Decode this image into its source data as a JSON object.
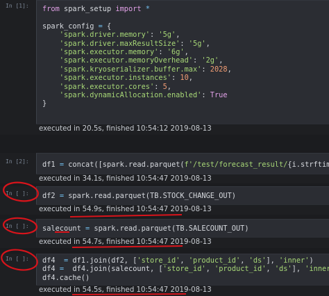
{
  "cells": [
    {
      "prompt": "In [1]:",
      "lines": [
        [
          {
            "t": "from ",
            "c": "kw"
          },
          {
            "t": "spark_setup ",
            "c": "fn"
          },
          {
            "t": "import",
            "c": "kw"
          },
          {
            "t": " *",
            "c": "op"
          }
        ],
        [],
        [
          {
            "t": "spark_config ",
            "c": "fn"
          },
          {
            "t": "=",
            "c": "op"
          },
          {
            "t": " {",
            "c": "fn"
          }
        ],
        [
          {
            "t": "    'spark.driver.memory'",
            "c": "str"
          },
          {
            "t": ": ",
            "c": "fn"
          },
          {
            "t": "'5g'",
            "c": "str"
          },
          {
            "t": ",",
            "c": "fn"
          }
        ],
        [
          {
            "t": "    'spark.driver.maxResultSize'",
            "c": "str"
          },
          {
            "t": ": ",
            "c": "fn"
          },
          {
            "t": "'5g'",
            "c": "str"
          },
          {
            "t": ",",
            "c": "fn"
          }
        ],
        [
          {
            "t": "    'spark.executor.memory'",
            "c": "str"
          },
          {
            "t": ": ",
            "c": "fn"
          },
          {
            "t": "'6g'",
            "c": "str"
          },
          {
            "t": ",",
            "c": "fn"
          }
        ],
        [
          {
            "t": "    'spark.executor.memoryOverhead'",
            "c": "str"
          },
          {
            "t": ": ",
            "c": "fn"
          },
          {
            "t": "'2g'",
            "c": "str"
          },
          {
            "t": ",",
            "c": "fn"
          }
        ],
        [
          {
            "t": "    'spark.kryoserializer.buffer.max'",
            "c": "str"
          },
          {
            "t": ": ",
            "c": "fn"
          },
          {
            "t": "2028",
            "c": "num"
          },
          {
            "t": ",",
            "c": "fn"
          }
        ],
        [
          {
            "t": "    'spark.executor.instances'",
            "c": "str"
          },
          {
            "t": ": ",
            "c": "fn"
          },
          {
            "t": "10",
            "c": "num"
          },
          {
            "t": ",",
            "c": "fn"
          }
        ],
        [
          {
            "t": "    'spark.executor.cores'",
            "c": "str"
          },
          {
            "t": ": ",
            "c": "fn"
          },
          {
            "t": "5",
            "c": "num"
          },
          {
            "t": ",",
            "c": "fn"
          }
        ],
        [
          {
            "t": "    'spark.dynamicAllocation.enabled'",
            "c": "str"
          },
          {
            "t": ": ",
            "c": "fn"
          },
          {
            "t": "True",
            "c": "tr"
          }
        ],
        [
          {
            "t": "}",
            "c": "fn"
          }
        ],
        [],
        [],
        [
          {
            "t": "spark ",
            "c": "fn"
          },
          {
            "t": "=",
            "c": "op"
          },
          {
            "t": " start_spark_session(",
            "c": "fn"
          },
          {
            "t": "'demand'",
            "c": "str"
          },
          {
            "t": ", master",
            "c": "fn"
          },
          {
            "t": "=",
            "c": "op"
          },
          {
            "t": "'yarn'",
            "c": "str"
          },
          {
            "t": ", spark_config",
            "c": "fn"
          },
          {
            "t": "=",
            "c": "op"
          },
          {
            "t": "spar",
            "c": "fn"
          }
        ]
      ],
      "exec": "executed in 20.5s, finished 10:54:12 2019-08-13"
    },
    {
      "prompt": "In [2]:",
      "lines": [
        [
          {
            "t": "df1 ",
            "c": "fn"
          },
          {
            "t": "=",
            "c": "op"
          },
          {
            "t": " concat([spark.read.parquet(",
            "c": "fn"
          },
          {
            "t": "f'/test/forecast_result/",
            "c": "str"
          },
          {
            "t": "{i.strftime(",
            "c": "fn"
          },
          {
            "t": "\"%",
            "c": "str"
          }
        ]
      ],
      "exec": "executed in 34.1s, finished 10:54:47 2019-08-13"
    },
    {
      "prompt": "In [ ]:",
      "lines": [
        [
          {
            "t": "df2 ",
            "c": "fn"
          },
          {
            "t": "=",
            "c": "op"
          },
          {
            "t": " spark.read.parquet(TB.STOCK_CHANGE_OUT)",
            "c": "fn"
          }
        ]
      ],
      "exec": "executed in 54.9s, finished 10:54:47 2019-08-13"
    },
    {
      "prompt": "In [ ]:",
      "lines": [
        [
          {
            "t": "salecount ",
            "c": "fn"
          },
          {
            "t": "=",
            "c": "op"
          },
          {
            "t": " spark.read.parquet(TB.SALECOUNT_OUT)",
            "c": "fn"
          }
        ]
      ],
      "exec": "executed in 54.7s, finished 10:54:47 2019-08-13"
    },
    {
      "prompt": "In [ ]:",
      "lines": [
        [
          {
            "t": "df4  ",
            "c": "fn"
          },
          {
            "t": "=",
            "c": "op"
          },
          {
            "t": " df1.join(df2, [",
            "c": "fn"
          },
          {
            "t": "'store_id'",
            "c": "str"
          },
          {
            "t": ", ",
            "c": "fn"
          },
          {
            "t": "'product_id'",
            "c": "str"
          },
          {
            "t": ", ",
            "c": "fn"
          },
          {
            "t": "'ds'",
            "c": "str"
          },
          {
            "t": "], ",
            "c": "fn"
          },
          {
            "t": "'inner'",
            "c": "str"
          },
          {
            "t": ")",
            "c": "fn"
          }
        ],
        [
          {
            "t": "df4 ",
            "c": "fn"
          },
          {
            "t": "=",
            "c": "op"
          },
          {
            "t": "  df4.join(salecount, [",
            "c": "fn"
          },
          {
            "t": "'store_id'",
            "c": "str"
          },
          {
            "t": ", ",
            "c": "fn"
          },
          {
            "t": "'product_id'",
            "c": "str"
          },
          {
            "t": ", ",
            "c": "fn"
          },
          {
            "t": "'ds'",
            "c": "str"
          },
          {
            "t": "], ",
            "c": "fn"
          },
          {
            "t": "'inner'",
            "c": "str"
          },
          {
            "t": ")",
            "c": "fn"
          }
        ],
        [
          {
            "t": "df4.cache()",
            "c": "fn"
          }
        ]
      ],
      "exec": "executed in 54.5s, finished 10:54:47 2019-08-13"
    }
  ],
  "annotation_color": "#d9141b"
}
